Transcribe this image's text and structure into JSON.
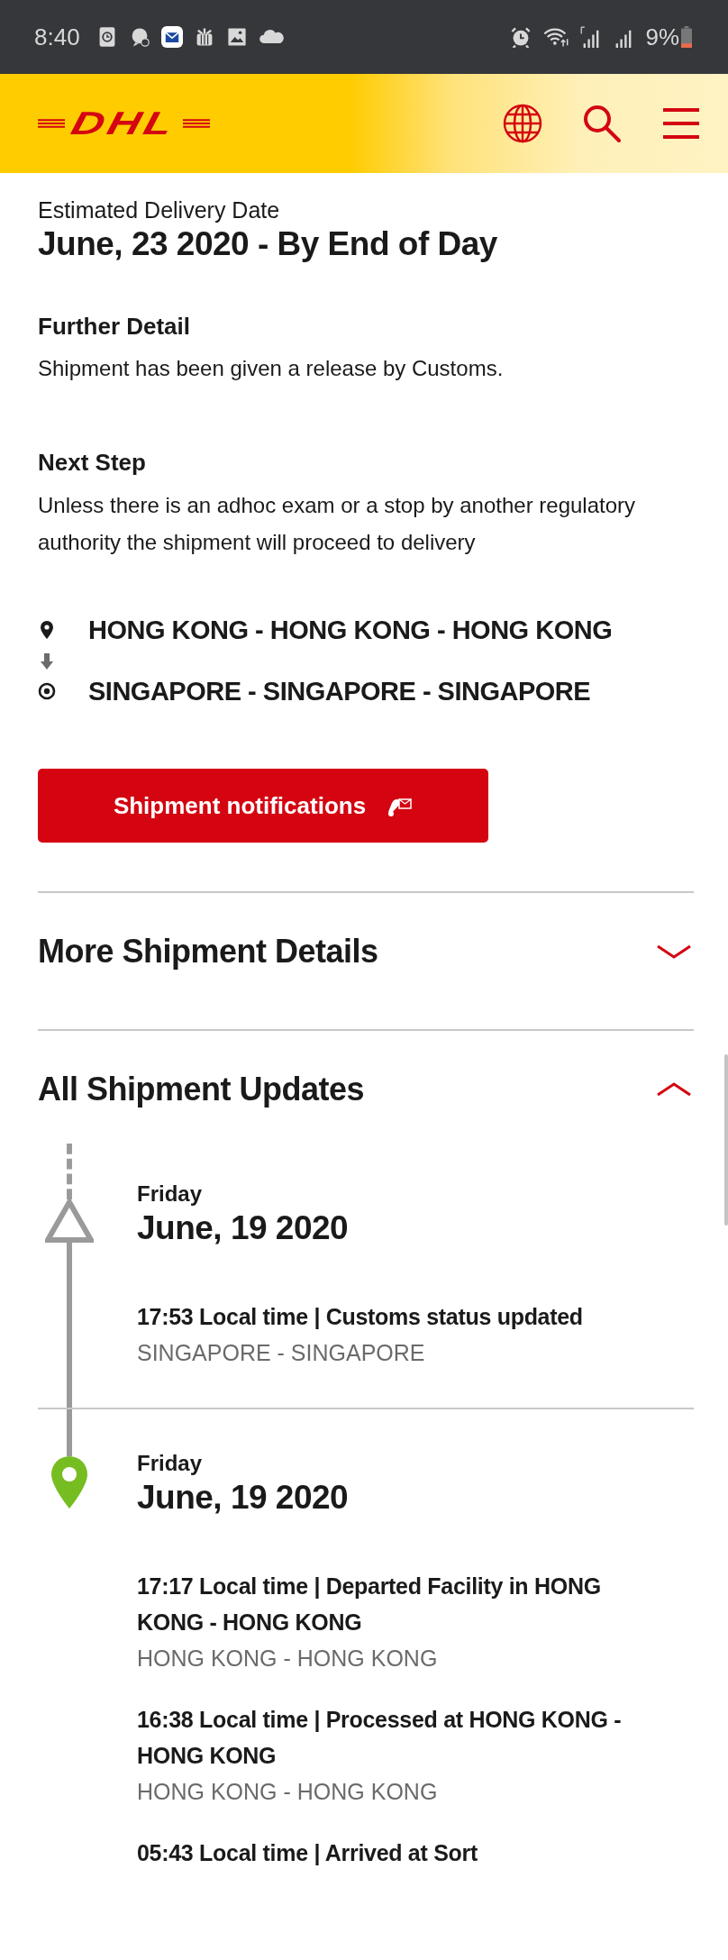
{
  "status_bar": {
    "time": "8:40",
    "battery": "9%"
  },
  "header": {
    "logo": "DHL"
  },
  "estimated_delivery": {
    "label": "Estimated Delivery Date",
    "value": "June, 23 2020 - By End of Day"
  },
  "further_detail": {
    "heading": "Further Detail",
    "text": "Shipment has been given a release by Customs."
  },
  "next_step": {
    "heading": "Next Step",
    "text": "Unless there is an adhoc exam or a stop by another regulatory authority the shipment will proceed to delivery"
  },
  "route": {
    "origin": "HONG KONG - HONG KONG - HONG KONG",
    "destination": "SINGAPORE - SINGAPORE - SINGAPORE"
  },
  "notification_button": {
    "label": "Shipment notifications"
  },
  "sections": [
    {
      "title": "More Shipment Details",
      "expanded": false
    },
    {
      "title": "All Shipment Updates",
      "expanded": true,
      "updates": [
        {
          "kind": "triangle",
          "day": "Friday",
          "date": "June, 19 2020",
          "events": [
            {
              "text": "17:53 Local time | Customs status updated",
              "location": "SINGAPORE - SINGAPORE"
            }
          ]
        },
        {
          "kind": "pin",
          "day": "Friday",
          "date": "June, 19 2020",
          "events": [
            {
              "text": "17:17 Local time | Departed Facility in HONG KONG - HONG KONG",
              "location": "HONG KONG - HONG KONG"
            },
            {
              "text": "16:38 Local time | Processed at HONG KONG - HONG KONG",
              "location": "HONG KONG - HONG KONG"
            },
            {
              "text": "05:43 Local time | Arrived at Sort"
            }
          ]
        }
      ]
    }
  ]
}
